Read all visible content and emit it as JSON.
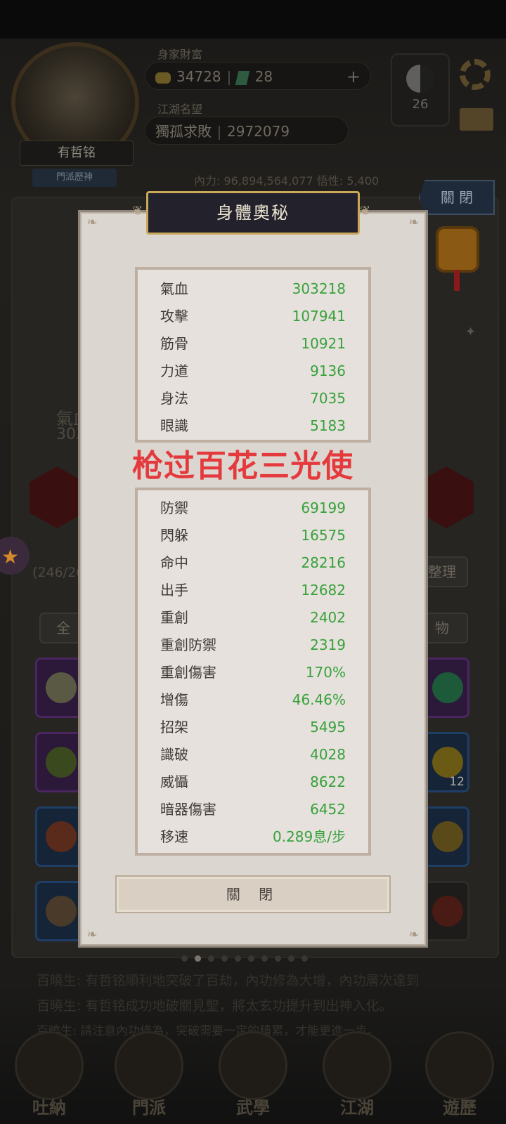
{
  "header": {
    "wealth_label": "身家財富",
    "coins": "34728",
    "gems": "28",
    "fame_label": "江湖名望",
    "fame_title": "獨孤求敗",
    "fame_value": "2972079",
    "player_name": "有哲铭",
    "player_subtitle": "門派歷神",
    "yin_yang_count": "26",
    "neili_line": "內力: 96,894,564,077   悟性: 5,400"
  },
  "background": {
    "close_button": "關 閉",
    "attr_label": "氣血",
    "attr_value": "303",
    "inventory_count": "(246/26",
    "organize_label": "整理",
    "tab_all": "全",
    "tab_items": "物",
    "item_count": "12",
    "bottom_text_1": "百曉生: 有哲铭順利地突破了百劫，內功修為大增，內功層次達到",
    "bottom_text_2": "百曉生: 有哲铭成功地破關見聖，將太玄功提升到出神入化。",
    "bottom_text_3": "百曉生: 請注意內功修為，突破需要一定的積累，才能更進一步。"
  },
  "nav": [
    {
      "label": "吐納"
    },
    {
      "label": "門派"
    },
    {
      "label": "武學"
    },
    {
      "label": "江湖"
    },
    {
      "label": "遊歷"
    }
  ],
  "modal": {
    "title": "身體奧秘",
    "watermark": "枪过百花三光使",
    "close_label": "關 閉",
    "primary_stats": [
      {
        "label": "氣血",
        "value": "303218"
      },
      {
        "label": "攻擊",
        "value": "107941"
      },
      {
        "label": "筋骨",
        "value": "10921"
      },
      {
        "label": "力道",
        "value": "9136"
      },
      {
        "label": "身法",
        "value": "7035"
      },
      {
        "label": "眼識",
        "value": "5183"
      }
    ],
    "secondary_stats": [
      {
        "label": "防禦",
        "value": "69199"
      },
      {
        "label": "閃躲",
        "value": "16575"
      },
      {
        "label": "命中",
        "value": "28216"
      },
      {
        "label": "出手",
        "value": "12682"
      },
      {
        "label": "重創",
        "value": "2402"
      },
      {
        "label": "重創防禦",
        "value": "2319"
      },
      {
        "label": "重創傷害",
        "value": "170%"
      },
      {
        "label": "增傷",
        "value": "46.46%"
      },
      {
        "label": "招架",
        "value": "5495"
      },
      {
        "label": "識破",
        "value": "4028"
      },
      {
        "label": "威懾",
        "value": "8622"
      },
      {
        "label": "暗器傷害",
        "value": "6452"
      },
      {
        "label": "移速",
        "value": "0.289息/步"
      }
    ]
  },
  "colors": {
    "stat_value": "#37a13b",
    "watermark": "#e43a3e",
    "title_bg": "#23222c",
    "title_border": "#c9a85a"
  }
}
